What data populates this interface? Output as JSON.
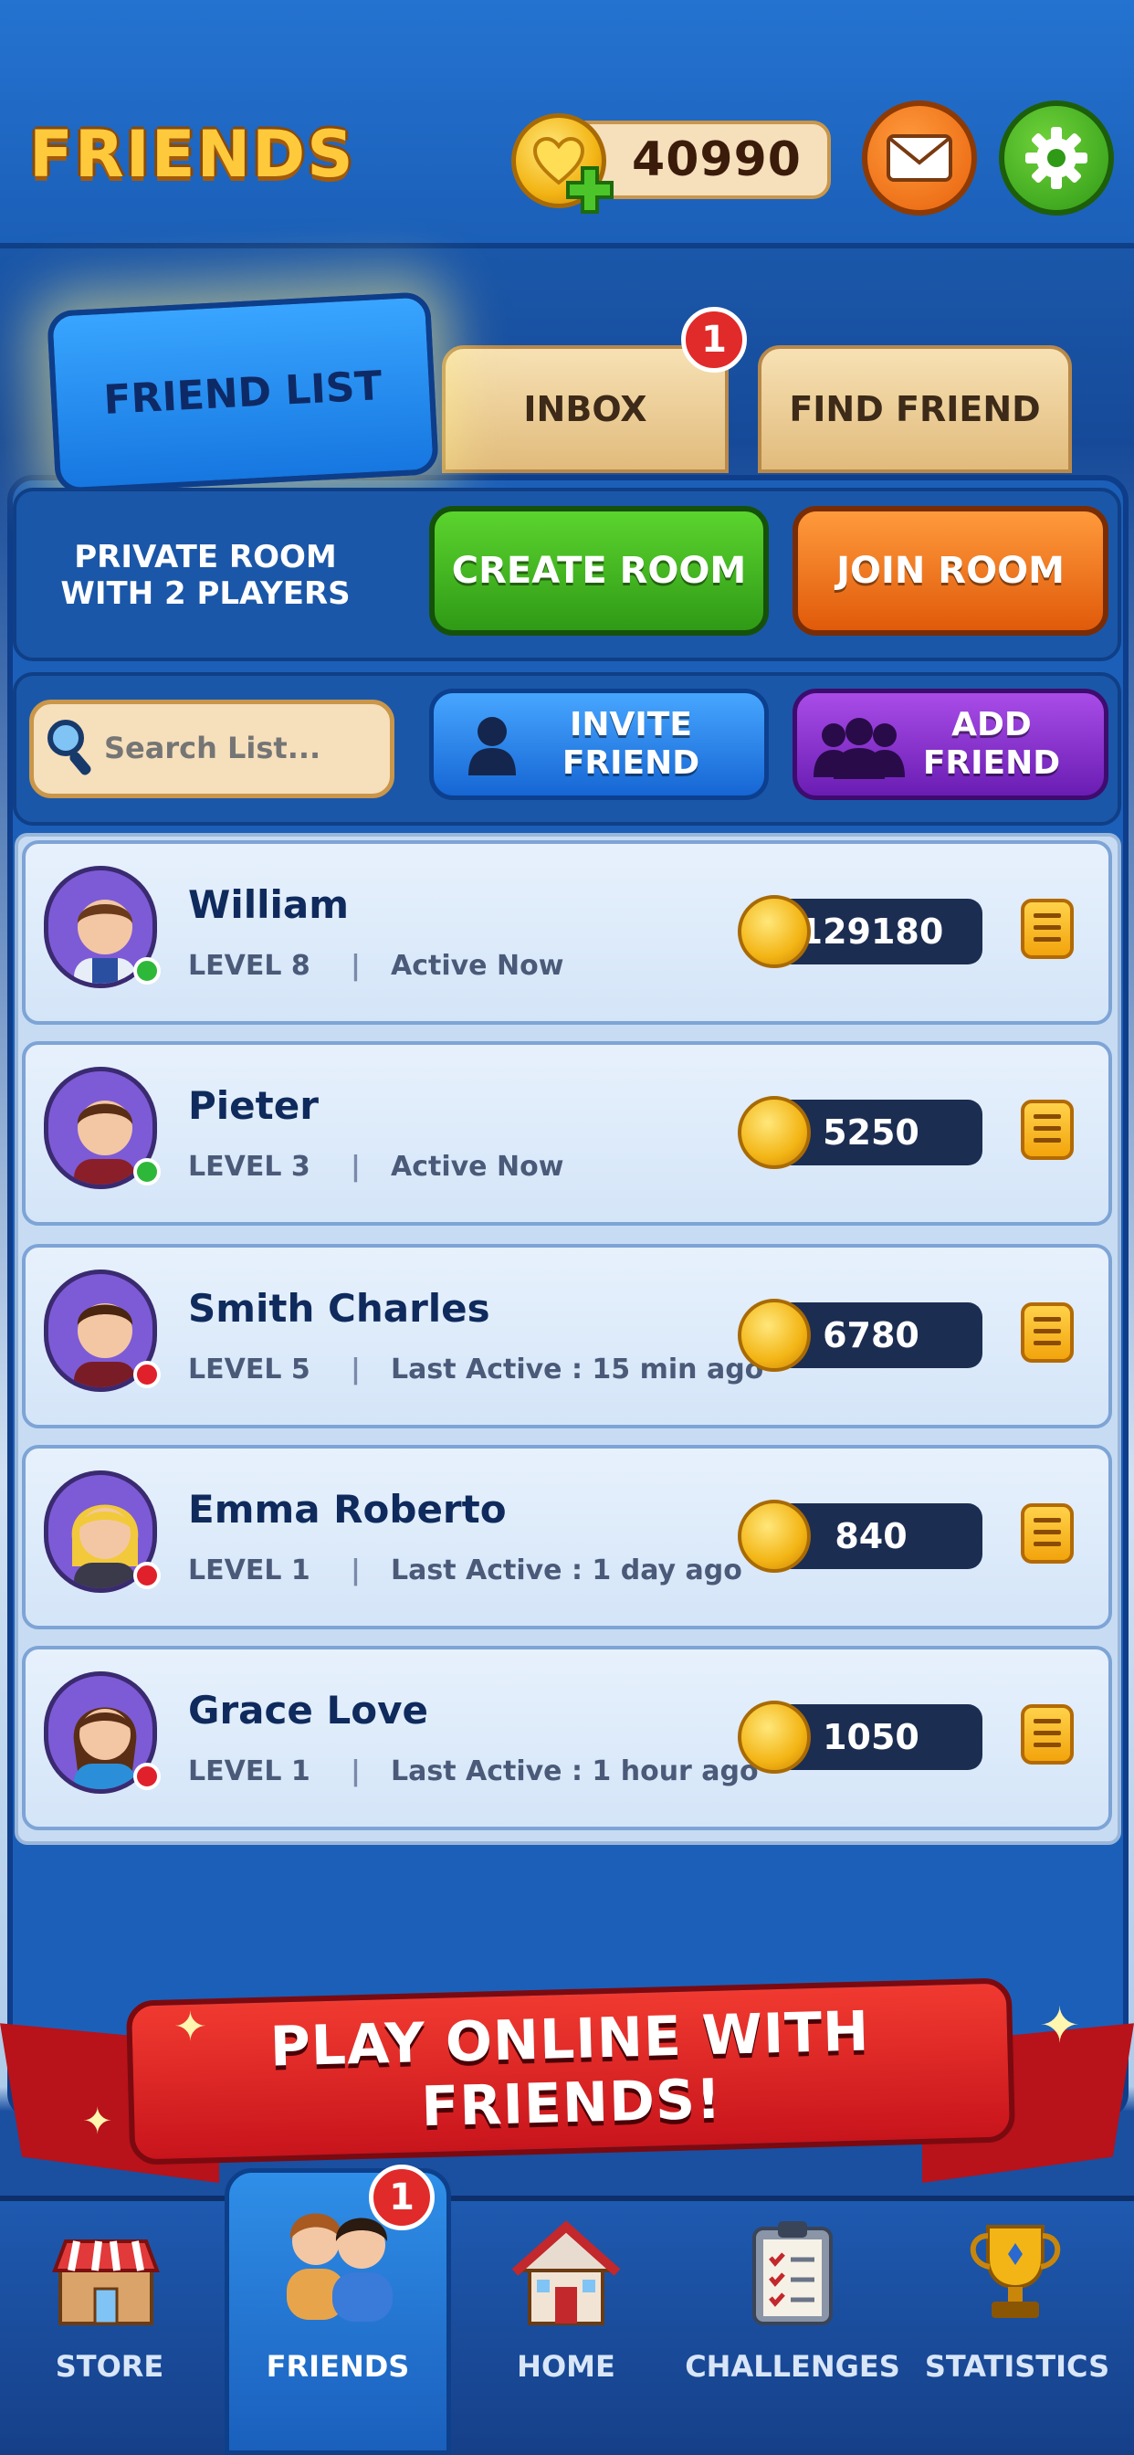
{
  "header": {
    "title": "FRIENDS",
    "coins": "40990"
  },
  "tabs": [
    {
      "label": "FRIEND LIST",
      "active": true
    },
    {
      "label": "INBOX",
      "badge": "1"
    },
    {
      "label": "FIND FRIEND"
    }
  ],
  "room": {
    "private_label": "PRIVATE ROOM\nWITH 2 PLAYERS",
    "create_label": "CREATE ROOM",
    "join_label": "JOIN ROOM"
  },
  "search": {
    "placeholder": "Search List..."
  },
  "actions": {
    "invite_label": "INVITE\nFRIEND",
    "add_label": "ADD\nFRIEND"
  },
  "friends": [
    {
      "name": "William",
      "level": "LEVEL 8",
      "status": "Active Now",
      "coins": "129180",
      "online": true
    },
    {
      "name": "Pieter",
      "level": "LEVEL 3",
      "status": "Active Now",
      "coins": "5250",
      "online": true
    },
    {
      "name": "Smith Charles",
      "level": "LEVEL 5",
      "status": "Last Active : 15 min ago",
      "coins": "6780",
      "online": false
    },
    {
      "name": "Emma Roberto",
      "level": "LEVEL 1",
      "status": "Last Active : 1 day ago",
      "coins": "840",
      "online": false
    },
    {
      "name": "Grace Love",
      "level": "LEVEL 1",
      "status": "Last Active : 1 hour ago",
      "coins": "1050",
      "online": false
    }
  ],
  "banner": "PLAY ONLINE WITH FRIENDS!",
  "nav": {
    "items": [
      {
        "label": "STORE",
        "icon": "store-icon"
      },
      {
        "label": "FRIENDS",
        "icon": "friends-icon",
        "active": true,
        "badge": "1"
      },
      {
        "label": "HOME",
        "icon": "home-icon"
      },
      {
        "label": "CHALLENGES",
        "icon": "clipboard-icon"
      },
      {
        "label": "STATISTICS",
        "icon": "trophy-icon"
      }
    ]
  },
  "colors": {
    "online": "#2eb83a",
    "offline": "#e0202a",
    "accent": "#ffc93c"
  }
}
